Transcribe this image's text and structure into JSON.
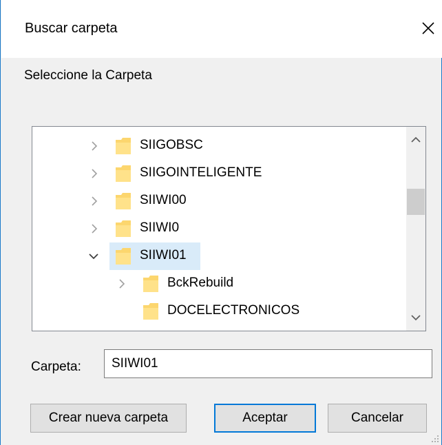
{
  "dialog": {
    "title": "Buscar carpeta",
    "prompt": "Seleccione la Carpeta"
  },
  "tree": {
    "items": [
      {
        "label": "SIIGOBSC",
        "level": 0,
        "expander": "collapsed"
      },
      {
        "label": "SIIGOINTELIGENTE",
        "level": 0,
        "expander": "collapsed"
      },
      {
        "label": "SIIWI00",
        "level": 0,
        "expander": "collapsed"
      },
      {
        "label": "SIIWI0",
        "level": 0,
        "expander": "collapsed"
      },
      {
        "label": "SIIWI01",
        "level": 0,
        "expander": "expanded",
        "selected": true
      },
      {
        "label": "BckRebuild",
        "level": 1,
        "expander": "collapsed"
      },
      {
        "label": "DOCELECTRONICOS",
        "level": 1,
        "expander": "none"
      },
      {
        "label": "",
        "level": 1,
        "expander": "none"
      }
    ]
  },
  "folder_field": {
    "label": "Carpeta:",
    "value": "SIIWI01"
  },
  "buttons": {
    "new_folder": "Crear nueva carpeta",
    "accept": "Aceptar",
    "cancel": "Cancelar"
  },
  "colors": {
    "selection": "#d9ebf9",
    "accent": "#0078d7",
    "folder": "#fcd66e",
    "window_border": "#1979ca"
  },
  "icons": {
    "close": "close-icon",
    "folder": "folder-icon",
    "expand": "chevron-right-icon",
    "collapse": "chevron-down-icon"
  }
}
